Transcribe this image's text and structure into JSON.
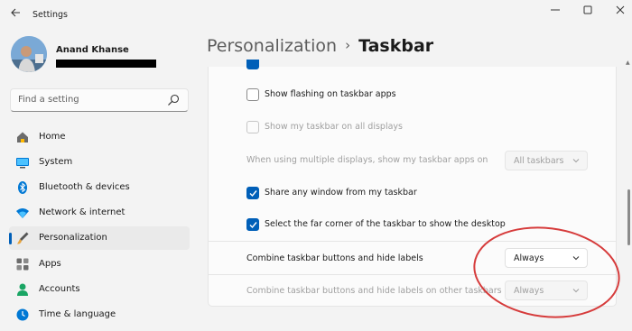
{
  "window": {
    "title": "Settings",
    "back_icon": "back-arrow-icon",
    "controls": [
      "minimize-icon",
      "maximize-icon",
      "close-icon"
    ]
  },
  "profile": {
    "name": "Anand Khanse"
  },
  "search": {
    "placeholder": "Find a setting"
  },
  "nav": {
    "items": [
      {
        "label": "Home",
        "icon": "home-icon"
      },
      {
        "label": "System",
        "icon": "system-icon"
      },
      {
        "label": "Bluetooth & devices",
        "icon": "bluetooth-icon"
      },
      {
        "label": "Network & internet",
        "icon": "network-icon"
      },
      {
        "label": "Personalization",
        "icon": "personalization-icon",
        "active": true
      },
      {
        "label": "Apps",
        "icon": "apps-icon"
      },
      {
        "label": "Accounts",
        "icon": "accounts-icon"
      },
      {
        "label": "Time & language",
        "icon": "time-language-icon"
      }
    ]
  },
  "breadcrumb": {
    "parent": "Personalization",
    "separator": "›",
    "current": "Taskbar"
  },
  "settings": {
    "show_flashing": {
      "label": "Show flashing on taskbar apps",
      "checked": false,
      "disabled": false
    },
    "show_all_displays": {
      "label": "Show my taskbar on all displays",
      "checked": false,
      "disabled": true
    },
    "multi_display": {
      "label": "When using multiple displays, show my taskbar apps on",
      "value": "All taskbars",
      "disabled": true
    },
    "share_window": {
      "label": "Share any window from my taskbar",
      "checked": true,
      "disabled": false
    },
    "far_corner": {
      "label": "Select the far corner of the taskbar to show the desktop",
      "checked": true,
      "disabled": false
    },
    "combine_buttons": {
      "label": "Combine taskbar buttons and hide labels",
      "value": "Always",
      "disabled": false
    },
    "combine_other": {
      "label": "Combine taskbar buttons and hide labels on other taskbars",
      "value": "Always",
      "disabled": true
    }
  },
  "colors": {
    "accent": "#005fb8",
    "annotation": "#d63b3b"
  }
}
